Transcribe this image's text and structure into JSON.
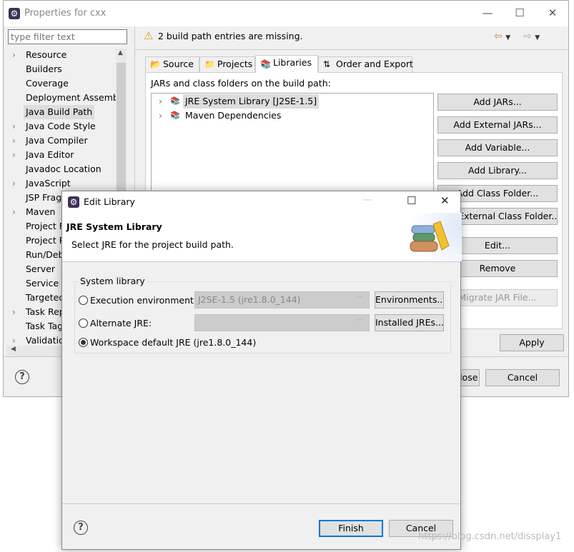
{
  "window": {
    "title": "Properties for cxx",
    "filter_placeholder": "type filter text",
    "tree": [
      {
        "label": "Resource",
        "expandable": true
      },
      {
        "label": "Builders"
      },
      {
        "label": "Coverage"
      },
      {
        "label": "Deployment Assembly"
      },
      {
        "label": "Java Build Path",
        "selected": true
      },
      {
        "label": "Java Code Style",
        "expandable": true
      },
      {
        "label": "Java Compiler",
        "expandable": true
      },
      {
        "label": "Java Editor",
        "expandable": true
      },
      {
        "label": "Javadoc Location"
      },
      {
        "label": "JavaScript",
        "expandable": true
      },
      {
        "label": "JSP Frag",
        "expandable": false
      },
      {
        "label": "Maven",
        "expandable": true
      },
      {
        "label": "Project F"
      },
      {
        "label": "Project R"
      },
      {
        "label": "Run/Deb"
      },
      {
        "label": "Server"
      },
      {
        "label": "Service P"
      },
      {
        "label": "Targeted"
      },
      {
        "label": "Task Rep",
        "expandable": true
      },
      {
        "label": "Task Tag"
      },
      {
        "label": "Validatio",
        "expandable": true
      }
    ],
    "warning": "2 build path entries are missing.",
    "tabs": [
      {
        "label": "Source"
      },
      {
        "label": "Projects"
      },
      {
        "label": "Libraries",
        "active": true
      },
      {
        "label": "Order and Export"
      }
    ],
    "libraries_label": "JARs and class folders on the build path:",
    "entries": [
      "JRE System Library [J2SE-1.5]",
      "Maven Dependencies"
    ],
    "buttons": [
      "Add JARs...",
      "Add External JARs...",
      "Add Variable...",
      "Add Library...",
      "Add Class Folder...",
      "Add External Class Folder...",
      "Edit...",
      "Remove",
      "Migrate JAR File..."
    ],
    "apply": "Apply",
    "close": "Apply and Close",
    "cancel": "Cancel"
  },
  "dialog": {
    "title": "Edit Library",
    "heading": "JRE System Library",
    "description": "Select JRE for the project build path.",
    "group_label": "System library",
    "exec_env_label": "Execution environment:",
    "exec_env_value": "J2SE-1.5 (jre1.8.0_144)",
    "environments_button": "Environments...",
    "alt_jre_label": "Alternate JRE:",
    "alt_jre_value": "",
    "installed_jres_button": "Installed JREs...",
    "workspace_label": "Workspace default JRE (jre1.8.0_144)",
    "selected_option": "workspace",
    "finish": "Finish",
    "cancel": "Cancel"
  },
  "watermark": "https://blog.csdn.net/dissplay1"
}
